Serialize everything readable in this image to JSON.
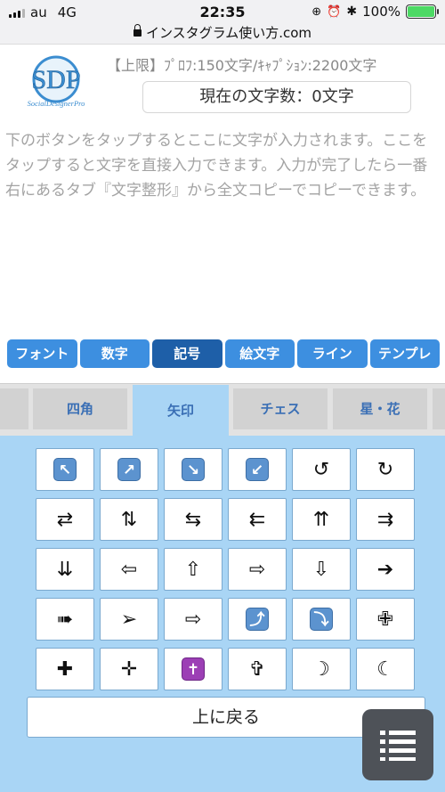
{
  "status_bar": {
    "carrier": "au",
    "network": "4G",
    "time": "22:35",
    "battery": "100%",
    "url": "インスタグラム使い方.com"
  },
  "logo": {
    "text": "SDP",
    "subtitle": "SocialDesignerPro"
  },
  "limit_text": "【上限】ﾌﾟﾛﾌ:150文字/ｷｬﾌﾟｼｮﾝ:2200文字",
  "counter_text": "現在の文字数：0文字",
  "editor_text": "下のボタンをタップするとここに文字が入力されます。ここをタップすると文字を直接入力できます。入力が完了したら一番右にあるタブ『文字整形』から全文コピーでコピーできます。",
  "main_tabs": [
    {
      "label": "フォント"
    },
    {
      "label": "数字"
    },
    {
      "label": "記号",
      "active": true
    },
    {
      "label": "絵文字"
    },
    {
      "label": "ライン"
    },
    {
      "label": "テンプレ"
    }
  ],
  "sub_tabs": [
    {
      "label": ""
    },
    {
      "label": "四角"
    },
    {
      "label": "矢印",
      "active": true
    },
    {
      "label": "チェス"
    },
    {
      "label": "星・花"
    },
    {
      "label": ""
    }
  ],
  "symbols": [
    {
      "char": "↖",
      "emoji": true
    },
    {
      "char": "↗",
      "emoji": true
    },
    {
      "char": "↘",
      "emoji": true
    },
    {
      "char": "↙",
      "emoji": true
    },
    {
      "char": "↺"
    },
    {
      "char": "↻"
    },
    {
      "char": "⇄"
    },
    {
      "char": "⇅"
    },
    {
      "char": "⇆"
    },
    {
      "char": "⇇"
    },
    {
      "char": "⇈"
    },
    {
      "char": "⇉"
    },
    {
      "char": "⇊"
    },
    {
      "char": "⇦"
    },
    {
      "char": "⇧"
    },
    {
      "char": "⇨"
    },
    {
      "char": "⇩"
    },
    {
      "char": "➔"
    },
    {
      "char": "➠"
    },
    {
      "char": "➢"
    },
    {
      "char": "⇨"
    },
    {
      "char": "⤴",
      "emoji": true
    },
    {
      "char": "⤵",
      "emoji": true
    },
    {
      "char": "✙"
    },
    {
      "char": "✚"
    },
    {
      "char": "✛"
    },
    {
      "char": "✝",
      "emoji": true,
      "color": "purple"
    },
    {
      "char": "✞"
    },
    {
      "char": "☽"
    },
    {
      "char": "☾"
    }
  ],
  "back_button": "上に戻る",
  "colors": {
    "tab_blue": "#3d8fe0",
    "tab_active": "#1e5fa8",
    "panel_blue": "#a9d5f5",
    "sub_tab_text": "#3a6fb5"
  }
}
